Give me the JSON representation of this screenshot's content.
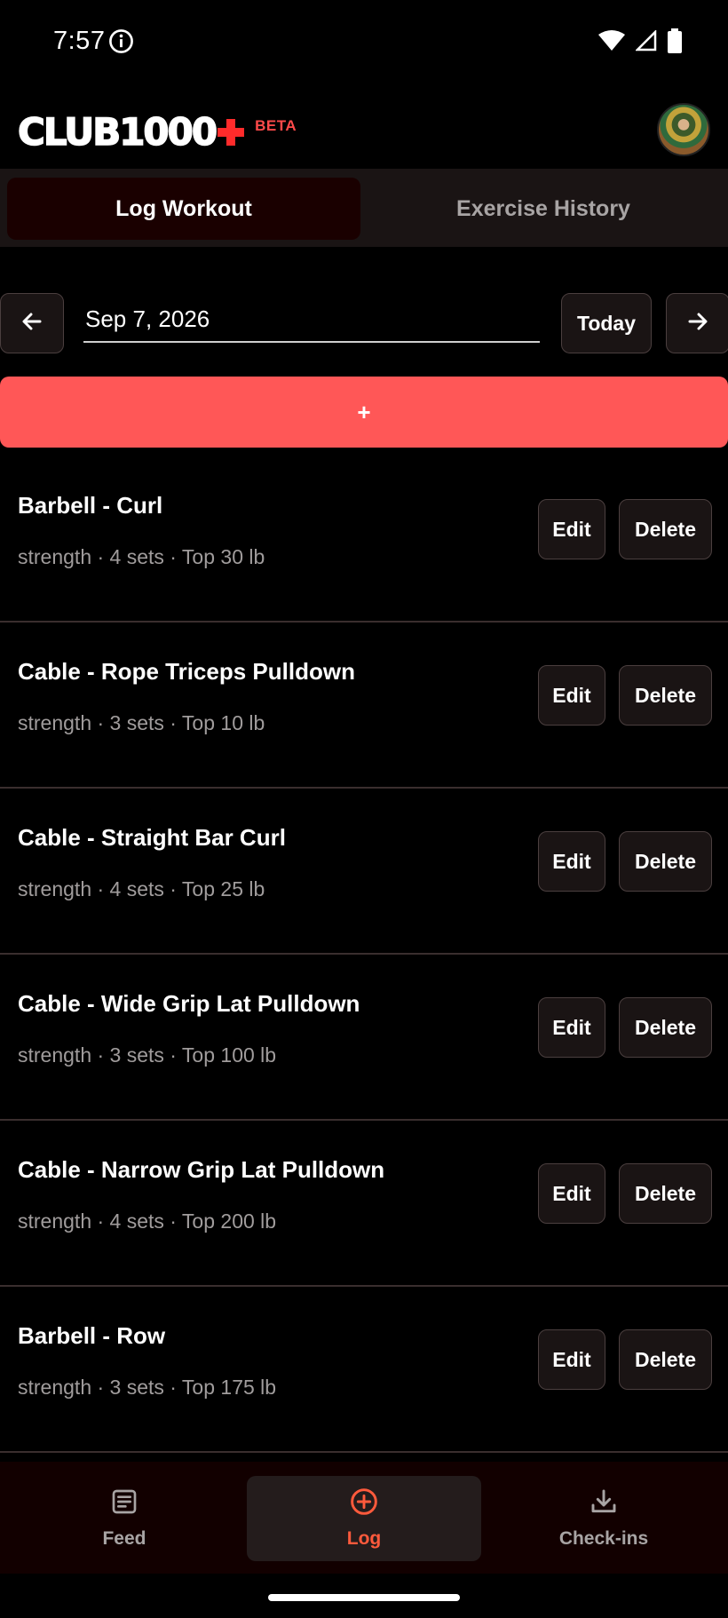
{
  "status_bar": {
    "time": "7:57"
  },
  "header": {
    "logo_text": "CLUB1000",
    "beta_label": "BETA"
  },
  "tabs": [
    {
      "label": "Log Workout",
      "active": true
    },
    {
      "label": "Exercise History",
      "active": false
    }
  ],
  "date_nav": {
    "prev_icon": "arrow-left-icon",
    "date_value": "Sep 7, 2026",
    "today_label": "Today",
    "next_icon": "arrow-right-icon"
  },
  "add_button": {
    "label": "+"
  },
  "exercises": [
    {
      "title": "Barbell - Curl",
      "meta": "strength · 4 sets · Top 30 lb",
      "edit_label": "Edit",
      "delete_label": "Delete"
    },
    {
      "title": "Cable - Rope Triceps Pulldown",
      "meta": "strength · 3 sets · Top 10 lb",
      "edit_label": "Edit",
      "delete_label": "Delete"
    },
    {
      "title": "Cable - Straight Bar Curl",
      "meta": "strength · 4 sets · Top 25 lb",
      "edit_label": "Edit",
      "delete_label": "Delete"
    },
    {
      "title": "Cable - Wide Grip Lat Pulldown",
      "meta": "strength · 3 sets · Top 100 lb",
      "edit_label": "Edit",
      "delete_label": "Delete"
    },
    {
      "title": "Cable - Narrow Grip Lat Pulldown",
      "meta": "strength · 4 sets · Top 200 lb",
      "edit_label": "Edit",
      "delete_label": "Delete"
    },
    {
      "title": "Barbell - Row",
      "meta": "strength · 3 sets · Top 175 lb",
      "edit_label": "Edit",
      "delete_label": "Delete"
    }
  ],
  "bottom_nav": [
    {
      "label": "Feed",
      "icon": "feed-icon",
      "active": false
    },
    {
      "label": "Log",
      "icon": "plus-circle-icon",
      "active": true
    },
    {
      "label": "Check-ins",
      "icon": "download-icon",
      "active": false
    }
  ],
  "colors": {
    "accent": "#ff5757",
    "active_nav": "#ff5a3c",
    "beta": "#ff4a4a"
  }
}
